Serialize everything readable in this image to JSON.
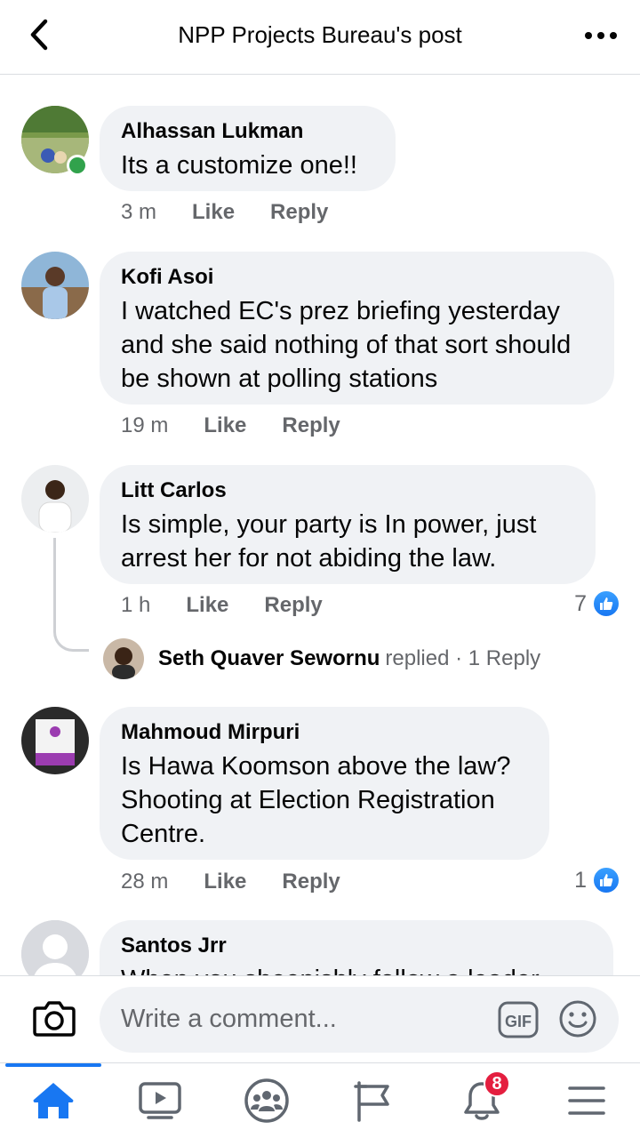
{
  "header": {
    "title": "NPP Projects Bureau's post"
  },
  "comments": [
    {
      "author": "Alhassan Lukman",
      "text": "Its a customize one!!",
      "time": "3 m",
      "like": "Like",
      "reply": "Reply"
    },
    {
      "author": "Kofi Asoi",
      "text": "I watched EC's prez briefing yesterday and she said nothing of that sort should be shown at polling stations",
      "time": "19 m",
      "like": "Like",
      "reply": "Reply"
    },
    {
      "author": "Litt Carlos",
      "text": "Is simple, your party is In power,  just arrest her for not abiding the law.",
      "time": "1 h",
      "like": "Like",
      "reply": "Reply",
      "reactions": "7"
    },
    {
      "author": "Mahmoud Mirpuri",
      "text": "Is Hawa Koomson above the law? Shooting at Election Registration Centre.",
      "time": "28 m",
      "like": "Like",
      "reply": "Reply",
      "reactions": "1"
    },
    {
      "author": "Santos Jrr",
      "text": "When you sheepishly follow a leader"
    }
  ],
  "reply_summary": {
    "name": "Seth Quaver Sewornu",
    "rest": "replied · 1 Reply"
  },
  "composer": {
    "placeholder": "Write a comment...",
    "gif": "GIF"
  },
  "nav": {
    "notifications_badge": "8"
  },
  "colors": {
    "accent": "#1877f2",
    "bubble": "#f0f2f5",
    "muted": "#65676b",
    "badge": "#e41e3f",
    "online": "#31a24c"
  }
}
